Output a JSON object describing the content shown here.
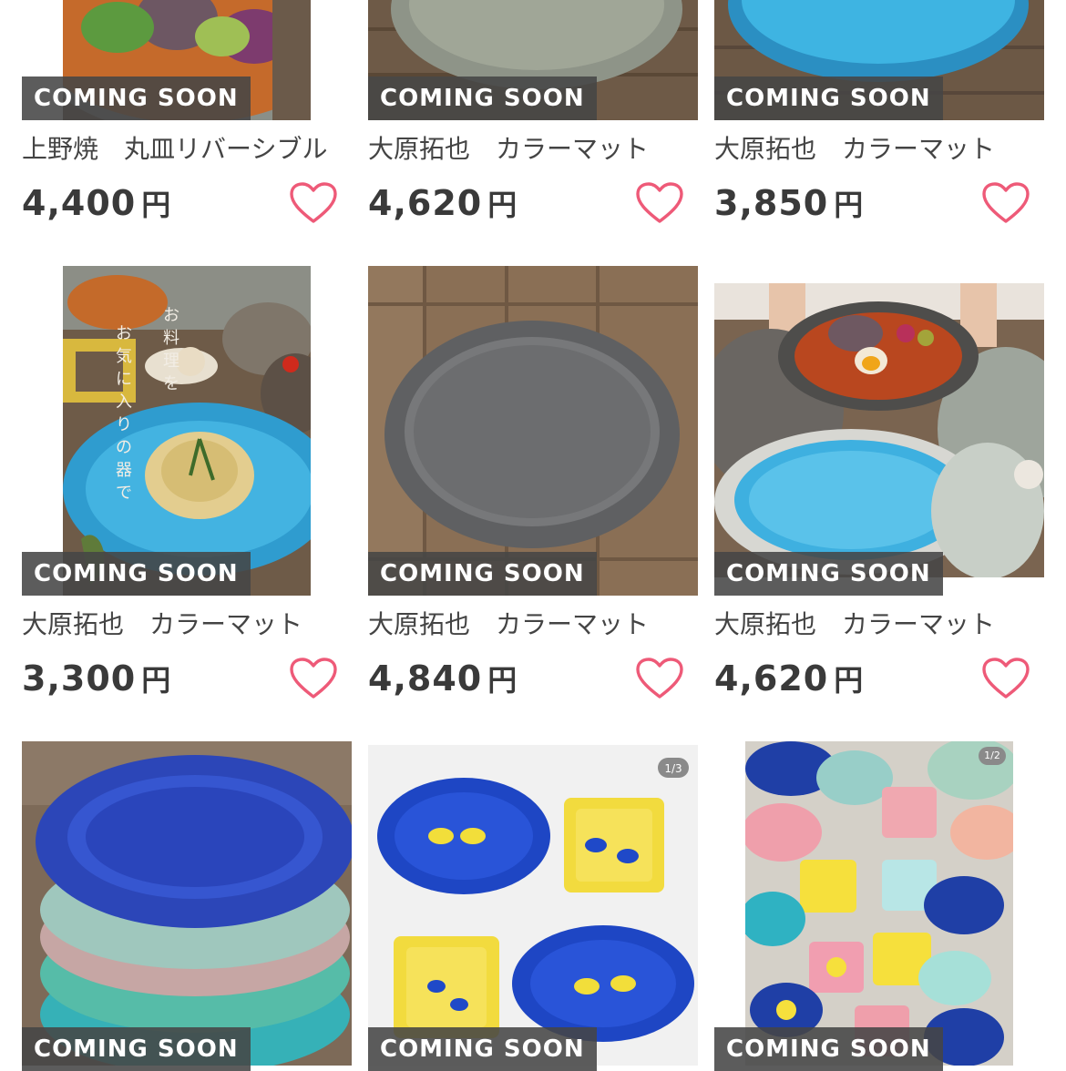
{
  "badge_label": "COMING SOON",
  "currency_unit": "円",
  "accent": {
    "heart": "#ee5a78",
    "badge_bg": "#464646"
  },
  "products": [
    {
      "name": "上野焼　丸皿リバーシブル",
      "price": "4,400"
    },
    {
      "name": "大原拓也　カラーマット",
      "price": "4,620"
    },
    {
      "name": "大原拓也　カラーマット",
      "price": "3,850"
    },
    {
      "name": "大原拓也　カラーマット",
      "price": "3,300"
    },
    {
      "name": "大原拓也　カラーマット",
      "price": "4,840"
    },
    {
      "name": "大原拓也　カラーマット",
      "price": "4,620"
    },
    {
      "name": "",
      "price": ""
    },
    {
      "name": "",
      "price": ""
    },
    {
      "name": "",
      "price": ""
    }
  ],
  "overlays": {
    "poster_text": "お料理を\nお気に入りの器で",
    "slide_counter_8": "1/3",
    "slide_counter_9": "1/2"
  },
  "icons": {
    "favorite": "heart-outline-icon"
  }
}
